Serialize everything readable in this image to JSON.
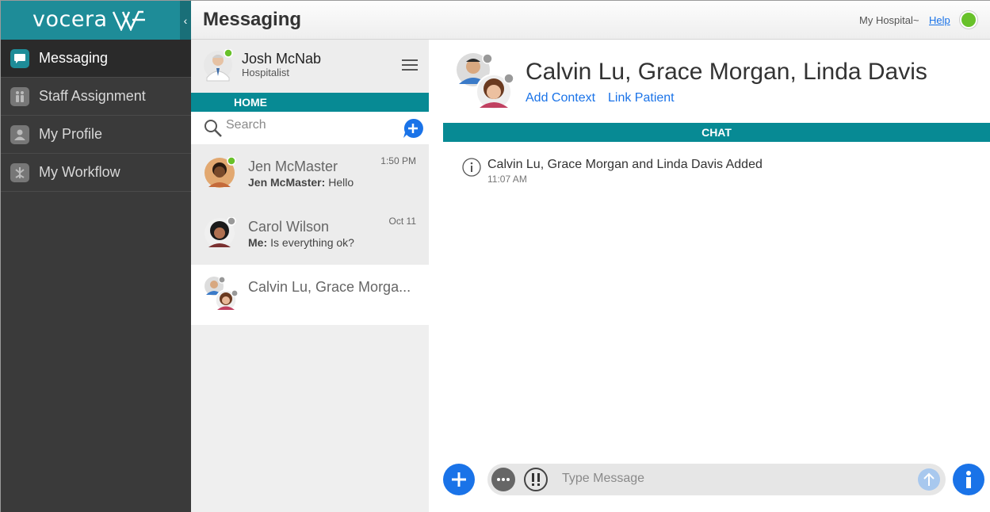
{
  "app": {
    "brand": "vocera",
    "page_title": "Messaging",
    "hospital": "My Hospital~",
    "help": "Help",
    "status_color": "#68c12a"
  },
  "sidebar": {
    "items": [
      {
        "label": "Messaging",
        "icon": "chat-icon",
        "active": true
      },
      {
        "label": "Staff Assignment",
        "icon": "staff-icon"
      },
      {
        "label": "My Profile",
        "icon": "person-icon"
      },
      {
        "label": "My Workflow",
        "icon": "workflow-icon"
      }
    ]
  },
  "user": {
    "name": "Josh McNab",
    "role": "Hospitalist"
  },
  "home_label": "HOME",
  "search": {
    "placeholder": "Search"
  },
  "conversations": [
    {
      "name": "Jen McMaster",
      "sender": "Jen McMaster:",
      "preview": "Hello",
      "time": "1:50 PM",
      "online": true
    },
    {
      "name": "Carol Wilson",
      "sender": "Me:",
      "preview": "Is everything ok?",
      "time": "Oct 11",
      "online": false
    },
    {
      "name": "Calvin Lu, Grace Morga...",
      "sender": "",
      "preview": "",
      "time": "",
      "online": false,
      "selected": true
    }
  ],
  "chat": {
    "title": "Calvin Lu, Grace Morgan, Linda Davis",
    "add_context": "Add Context",
    "link_patient": "Link Patient",
    "section_label": "CHAT",
    "system_message": "Calvin Lu, Grace Morgan and Linda Davis Added",
    "system_time": "11:07 AM",
    "composer_placeholder": "Type Message"
  },
  "colors": {
    "teal": "#078a94",
    "blue": "#1a73e8",
    "nav_bg": "#3a3a3a"
  }
}
